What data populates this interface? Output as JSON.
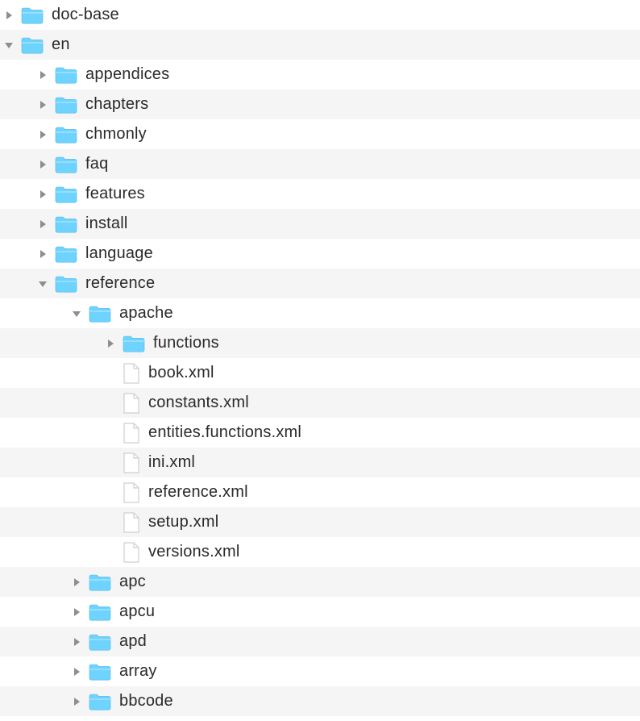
{
  "rows": [
    {
      "label": "doc-base",
      "type": "folder",
      "state": "closed",
      "indent": 0
    },
    {
      "label": "en",
      "type": "folder",
      "state": "open",
      "indent": 0
    },
    {
      "label": "appendices",
      "type": "folder",
      "state": "closed",
      "indent": 1
    },
    {
      "label": "chapters",
      "type": "folder",
      "state": "closed",
      "indent": 1
    },
    {
      "label": "chmonly",
      "type": "folder",
      "state": "closed",
      "indent": 1
    },
    {
      "label": "faq",
      "type": "folder",
      "state": "closed",
      "indent": 1
    },
    {
      "label": "features",
      "type": "folder",
      "state": "closed",
      "indent": 1
    },
    {
      "label": "install",
      "type": "folder",
      "state": "closed",
      "indent": 1
    },
    {
      "label": "language",
      "type": "folder",
      "state": "closed",
      "indent": 1
    },
    {
      "label": "reference",
      "type": "folder",
      "state": "open",
      "indent": 1
    },
    {
      "label": "apache",
      "type": "folder",
      "state": "open",
      "indent": 2
    },
    {
      "label": "functions",
      "type": "folder",
      "state": "closed",
      "indent": 3
    },
    {
      "label": "book.xml",
      "type": "file",
      "state": "none",
      "indent": 3
    },
    {
      "label": "constants.xml",
      "type": "file",
      "state": "none",
      "indent": 3
    },
    {
      "label": "entities.functions.xml",
      "type": "file",
      "state": "none",
      "indent": 3
    },
    {
      "label": "ini.xml",
      "type": "file",
      "state": "none",
      "indent": 3
    },
    {
      "label": "reference.xml",
      "type": "file",
      "state": "none",
      "indent": 3
    },
    {
      "label": "setup.xml",
      "type": "file",
      "state": "none",
      "indent": 3
    },
    {
      "label": "versions.xml",
      "type": "file",
      "state": "none",
      "indent": 3
    },
    {
      "label": "apc",
      "type": "folder",
      "state": "closed",
      "indent": 2
    },
    {
      "label": "apcu",
      "type": "folder",
      "state": "closed",
      "indent": 2
    },
    {
      "label": "apd",
      "type": "folder",
      "state": "closed",
      "indent": 2
    },
    {
      "label": "array",
      "type": "folder",
      "state": "closed",
      "indent": 2
    },
    {
      "label": "bbcode",
      "type": "folder",
      "state": "closed",
      "indent": 2
    }
  ],
  "icons": {
    "disclosure_closed": "▶",
    "disclosure_open": "▼",
    "folder": "folder-icon",
    "file": "file-icon"
  },
  "colors": {
    "folder": "#6fd3ff",
    "folder_stroke": "#4cb7e8",
    "file_stroke": "#cfcfcf",
    "disclosure": "#8e8e8e",
    "stripe": "#f5f5f5"
  }
}
